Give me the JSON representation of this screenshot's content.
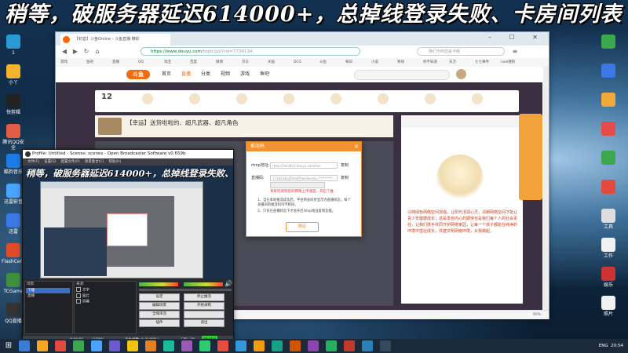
{
  "banner": "稍等，破服务器延迟614000+，总掉线登录失败、卡房间列表",
  "desktop_left_icons": [
    {
      "label": "1",
      "icon": "app-icon",
      "color": "#2a9ad4"
    },
    {
      "label": "小丫",
      "icon": "app-icon",
      "color": "#f6b12d"
    },
    {
      "label": "快剪辑",
      "icon": "app-icon",
      "color": "#222"
    },
    {
      "label": "腾讯QQ安全",
      "icon": "app-icon",
      "color": "#e25b45"
    },
    {
      "label": "酷狗音乐",
      "icon": "app-icon",
      "color": "#1c7be5"
    },
    {
      "label": "迅雷影音",
      "icon": "app-icon",
      "color": "#4aa3ff"
    },
    {
      "label": "迅雷",
      "icon": "app-icon",
      "color": "#3b78e7"
    },
    {
      "label": "FlashCenter",
      "icon": "app-icon",
      "color": "#e04b2b"
    },
    {
      "label": "TCGame",
      "icon": "app-icon",
      "color": "#3f8f3f"
    },
    {
      "label": "QQ直播",
      "icon": "app-icon",
      "color": "#333"
    }
  ],
  "desktop_right_icons": [
    {
      "label": "",
      "icon": "app-icon",
      "color": "#3aa84d"
    },
    {
      "label": "",
      "icon": "app-icon",
      "color": "#3b78e7"
    },
    {
      "label": "",
      "icon": "app-icon",
      "color": "#f2a93b"
    },
    {
      "label": "",
      "icon": "app-icon",
      "color": "#e64a4a"
    },
    {
      "label": "",
      "icon": "app-icon",
      "color": "#3aa84d"
    },
    {
      "label": "",
      "icon": "app-icon",
      "color": "#e14a3c"
    },
    {
      "label": "工具",
      "icon": "app-icon",
      "color": "#ddd"
    },
    {
      "label": "工作",
      "icon": "app-icon",
      "color": "#f1f1f1"
    },
    {
      "label": "娱乐",
      "icon": "app-icon",
      "color": "#c33"
    },
    {
      "label": "照片",
      "icon": "app-icon",
      "color": "#f1f1f1"
    }
  ],
  "browser": {
    "tab_title": "【初音】斗鱼Online - 斗鱼直播·精彩",
    "window_controls": "– ☐ ✕",
    "url_main": "https://www.douyu.com",
    "url_rest": "/topic/jyjl?rid=7734134",
    "search_placeholder": "我们为何还会卡呢",
    "bookmarks": [
      "游戏",
      "鱼吧",
      "直播",
      "QQ",
      "淘宝",
      "百度",
      "微博",
      "京东",
      "天猫",
      "DCG",
      "斗鱼",
      "每日",
      "小说",
      "秀场",
      "你不知道",
      "东方",
      "七七事件",
      "cool搜狗"
    ],
    "site_logo": "斗鱼",
    "site_nav": [
      "首页",
      "直播",
      "分类",
      "视频",
      "游戏",
      "鱼吧"
    ],
    "category_number": "12",
    "room_title": "【幸运】送货啦啦的、超凡武器、超凡角色",
    "chat_message": "以纯绿色网络空间加强，让阳光浸润心灵，清朗网络空间才能让青少年健康成长；这是发自内心的期待也是我们每个人的社会责任，让我们携手共同守护网络家园，让每一个孩子都能在纯净的环境中茁壮成长，共建文明网络环境，从我做起。",
    "status_zoom": "90%"
  },
  "dialog": {
    "title": "推流码",
    "close": "✕",
    "rtmp_label": "rtmp地址:",
    "rtmp_value": "rtmp://sendtc3.douyu.com/live",
    "copy1": "复制",
    "code_label": "直播码:",
    "code_value": "7734134rjZhhSdf?wsSecret=*********",
    "copy2": "复制",
    "warning": "系统检测到您的网络上传速度，开启了推",
    "note1": "1、当在本地推流成功后，平台将会同步显示为直播状态，每个直播间的推流码均不相同。",
    "note2": "2、只有在直播状态下才会开启rtmp地址复制功能。",
    "ok_label": "确定"
  },
  "obs": {
    "title": "Profile: Untitled - Scenes: scenes - Open Broadcaster Software v0.659b",
    "menu": [
      "文件(F)",
      "设置(S)",
      "配置文件(P)",
      "场景集合(C)",
      "帮助(H)"
    ],
    "overlay_text": "稍等，破服务器延迟614000+，总掉线登录失败、卡房间列表",
    "scenes_header": "场景:",
    "scene_selected": "下播",
    "scene_items": [
      "下播",
      "直播"
    ],
    "sources_header": "来源:",
    "sources": [
      "文字",
      "图片",
      "屏幕"
    ],
    "buttons": [
      "设定",
      "停止推流",
      "编辑场景",
      "开始录制",
      "全域串流",
      "",
      "插件",
      "退出"
    ],
    "status": [
      "0:00:01",
      "(1298)",
      "丢失帧数: 0 (0.00%)",
      "FPS: 30",
      "00 kb/s"
    ]
  },
  "taskbar": {
    "tray_lang": "ENG",
    "time": "20:54"
  }
}
